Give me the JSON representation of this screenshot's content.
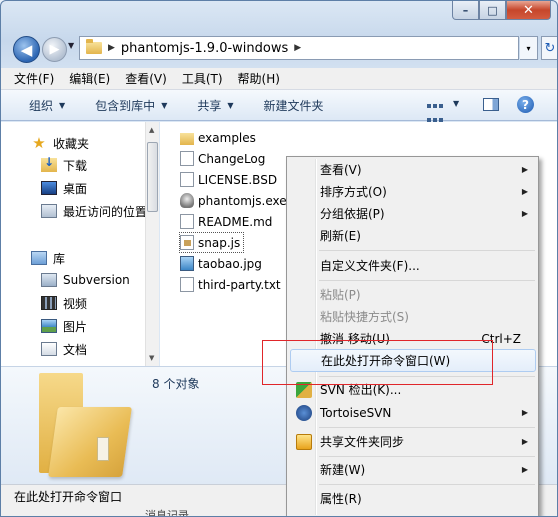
{
  "window": {
    "caption": {
      "minimize": "–",
      "maximize": "□",
      "close": "✕"
    }
  },
  "address": {
    "path": "phantomjs-1.9.0-windows",
    "sep": "▶",
    "drop": "▾"
  },
  "menu": [
    "文件(F)",
    "编辑(E)",
    "查看(V)",
    "工具(T)",
    "帮助(H)"
  ],
  "commands": [
    {
      "label": "组织",
      "has_arrow": true
    },
    {
      "label": "包含到库中",
      "has_arrow": true
    },
    {
      "label": "共享",
      "has_arrow": true
    },
    {
      "label": "新建文件夹",
      "has_arrow": false
    }
  ],
  "nav": {
    "favorites": "收藏夹",
    "downloads": "下载",
    "desktop": "桌面",
    "recent": "最近访问的位置",
    "libraries": "库",
    "svn": "Subversion",
    "videos": "视频",
    "pictures": "图片",
    "documents": "文档"
  },
  "files": [
    {
      "name": "examples",
      "icon": "folder-icon"
    },
    {
      "name": "ChangeLog",
      "icon": "document-icon"
    },
    {
      "name": "LICENSE.BSD",
      "icon": "document-icon"
    },
    {
      "name": "phantomjs.exe",
      "icon": "ghost-app-icon"
    },
    {
      "name": "README.md",
      "icon": "document-icon"
    },
    {
      "name": "snap.js",
      "icon": "script-icon"
    },
    {
      "name": "taobao.jpg",
      "icon": "image-icon"
    },
    {
      "name": "third-party.txt",
      "icon": "document-icon"
    }
  ],
  "details": {
    "count": "8 个对象"
  },
  "status": {
    "text": "在此处打开命令窗口",
    "cut": "消息记录"
  },
  "context_menu": {
    "view": "查看(V)",
    "sort": "排序方式(O)",
    "group": "分组依据(P)",
    "refresh": "刷新(E)",
    "customize": "自定义文件夹(F)...",
    "paste": "粘贴(P)",
    "paste_shortcut": "粘贴快捷方式(S)",
    "undo": "撤消 移动(U)",
    "undo_shortcut": "Ctrl+Z",
    "open_cmd": "在此处打开命令窗口(W)",
    "svn_checkout": "SVN 检出(K)...",
    "tortoise": "TortoiseSVN",
    "share_sync": "共享文件夹同步",
    "new": "新建(W)",
    "properties": "属性(R)"
  },
  "colors": {
    "highlight_box": "#e0262a",
    "accent": "#1e395b"
  }
}
